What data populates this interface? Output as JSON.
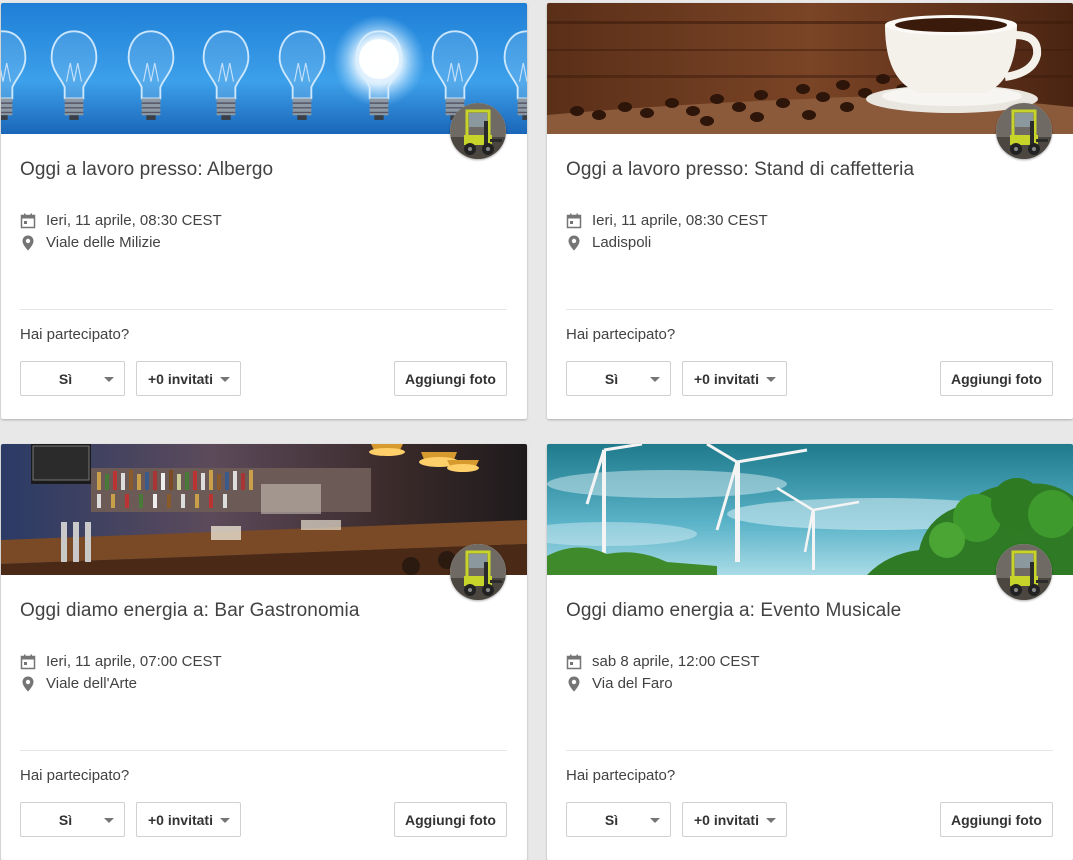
{
  "cards": [
    {
      "title": "Oggi a lavoro presso: Albergo",
      "date": "Ieri, 11 aprile, 08:30 CEST",
      "place": "Viale delle Milizie",
      "image": "light-bulbs",
      "question": "Hai partecipato?",
      "attend_value": "Sì",
      "guests_value": "+0 invitati",
      "add_photo_label": "Aggiungi foto"
    },
    {
      "title": "Oggi a lavoro presso: Stand di caffetteria",
      "date": "Ieri, 11 aprile, 08:30 CEST",
      "place": "Ladispoli",
      "image": "coffee-cup-and-beans",
      "question": "Hai partecipato?",
      "attend_value": "Sì",
      "guests_value": "+0 invitati",
      "add_photo_label": "Aggiungi foto"
    },
    {
      "title": "Oggi diamo energia a: Bar Gastronomia",
      "date": "Ieri, 11 aprile, 07:00 CEST",
      "place": "Viale dell'Arte",
      "image": "bar-counter",
      "question": "Hai partecipato?",
      "attend_value": "Sì",
      "guests_value": "+0 invitati",
      "add_photo_label": "Aggiungi foto"
    },
    {
      "title": "Oggi diamo energia a: Evento Musicale",
      "date": "sab 8 aprile, 12:00 CEST",
      "place": "Via del Faro",
      "image": "wind-turbines",
      "question": "Hai partecipato?",
      "attend_value": "Sì",
      "guests_value": "+0 invitati",
      "add_photo_label": "Aggiungi foto"
    }
  ],
  "icons": {
    "date": "calendar-icon",
    "place": "location-pin-icon",
    "dropdown": "caret-down-icon",
    "avatar": "forklift-avatar"
  },
  "colors": {
    "page_background": "#e8e8e8",
    "card_background": "#ffffff",
    "text": "#424242",
    "icon": "#757575",
    "divider": "#e6e6e6"
  }
}
